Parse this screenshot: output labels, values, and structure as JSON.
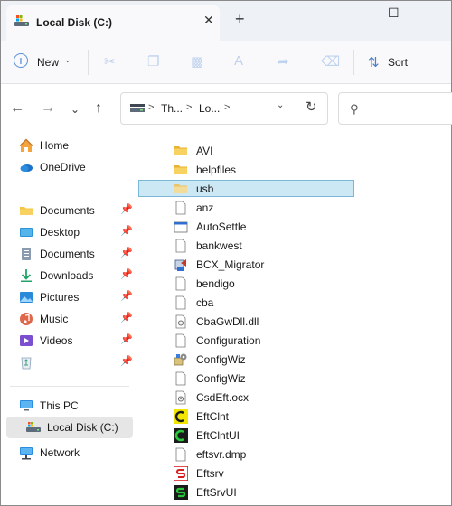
{
  "window": {
    "tab_title": "Local Disk (C:)",
    "colors": {
      "accent": "#0067c0",
      "selection_fill": "#cce8f4",
      "selection_border": "#7bb7d9",
      "folder": "#f5c542"
    }
  },
  "titlebar": {
    "new_tab_glyph": "+",
    "close_tab_glyph": "✕",
    "minimize_glyph": "—",
    "maximize_glyph": "☐"
  },
  "toolbar": {
    "new_label": "New",
    "sort_label": "Sort"
  },
  "address": {
    "crumbs": [
      "Th...",
      "Lo..."
    ]
  },
  "nav_pane": {
    "items": [
      {
        "label": "Home",
        "icon": "home-icon"
      },
      {
        "label": "OneDrive",
        "icon": "cloud-icon"
      },
      {
        "label": "Documents",
        "icon": "folder-icon",
        "pinned": true
      },
      {
        "label": "Desktop",
        "icon": "desktop-icon",
        "pinned": true
      },
      {
        "label": "Documents",
        "icon": "documents-icon",
        "pinned": true
      },
      {
        "label": "Downloads",
        "icon": "download-icon",
        "pinned": true
      },
      {
        "label": "Pictures",
        "icon": "pictures-icon",
        "pinned": true
      },
      {
        "label": "Music",
        "icon": "music-icon",
        "pinned": true
      },
      {
        "label": "Videos",
        "icon": "videos-icon",
        "pinned": true
      },
      {
        "label": "",
        "icon": "recycle-bin-icon",
        "pinned": true
      },
      {
        "label": "This PC",
        "icon": "pc-icon"
      },
      {
        "label": "Local Disk (C:)",
        "icon": "drive-icon",
        "selected": true
      },
      {
        "label": "Network",
        "icon": "network-icon"
      }
    ]
  },
  "files": [
    {
      "name": "AVI",
      "icon": "folder-icon"
    },
    {
      "name": "helpfiles",
      "icon": "folder-icon"
    },
    {
      "name": "usb",
      "icon": "folder-icon",
      "selected": true
    },
    {
      "name": "anz",
      "icon": "file-icon"
    },
    {
      "name": "AutoSettle",
      "icon": "app-window-icon"
    },
    {
      "name": "bankwest",
      "icon": "file-icon"
    },
    {
      "name": "BCX_Migrator",
      "icon": "migrator-icon"
    },
    {
      "name": "bendigo",
      "icon": "file-icon"
    },
    {
      "name": "cba",
      "icon": "file-icon"
    },
    {
      "name": "CbaGwDll.dll",
      "icon": "dll-icon"
    },
    {
      "name": "Configuration",
      "icon": "file-icon"
    },
    {
      "name": "ConfigWiz",
      "icon": "setup-icon"
    },
    {
      "name": "ConfigWiz",
      "icon": "file-icon"
    },
    {
      "name": "CsdEft.ocx",
      "icon": "dll-icon"
    },
    {
      "name": "EftClnt",
      "icon": "eftclnt-yellow-icon"
    },
    {
      "name": "EftClntUI",
      "icon": "eftclnt-green-icon"
    },
    {
      "name": "eftsvr.dmp",
      "icon": "file-icon"
    },
    {
      "name": "Eftsrv",
      "icon": "eftsrv-red-icon"
    },
    {
      "name": "EftSrvUI",
      "icon": "eftsrv-green-icon"
    }
  ]
}
